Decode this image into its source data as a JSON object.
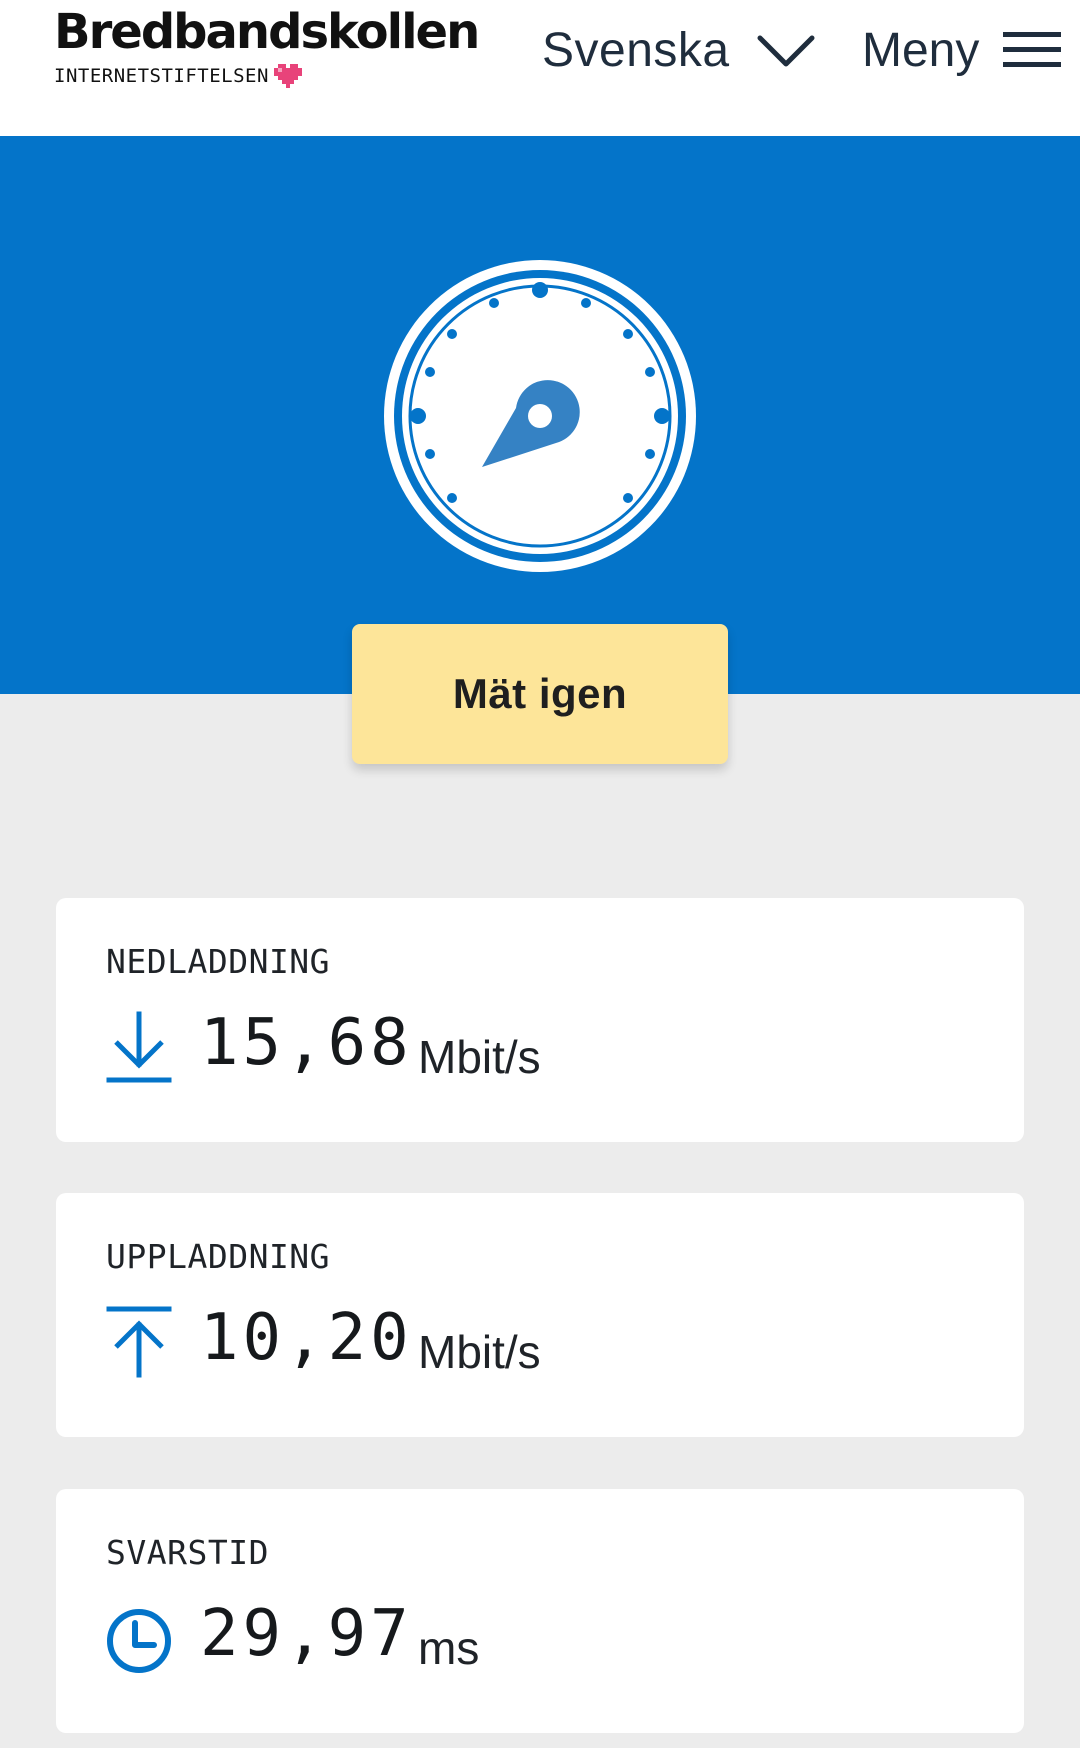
{
  "header": {
    "logo_title": "Bredbandskollen",
    "logo_subtitle": "INTERNETSTIFTELSEN",
    "language_label": "Svenska",
    "menu_label": "Meny"
  },
  "hero": {
    "gauge_icon": "speedometer-icon",
    "measure_button_label": "Mät igen"
  },
  "results": {
    "download": {
      "label": "NEDLADDNING",
      "value": "15,68",
      "unit": "Mbit/s",
      "icon": "download-arrow-icon"
    },
    "upload": {
      "label": "UPPLADDNING",
      "value": "10,20",
      "unit": "Mbit/s",
      "icon": "upload-arrow-icon"
    },
    "latency": {
      "label": "SVARSTID",
      "value": "29,97",
      "unit": "ms",
      "icon": "clock-icon"
    }
  },
  "colors": {
    "brand_blue": "#0474c9",
    "button_yellow": "#fde599",
    "page_background": "#ececec",
    "heart_pink": "#e8437a"
  }
}
